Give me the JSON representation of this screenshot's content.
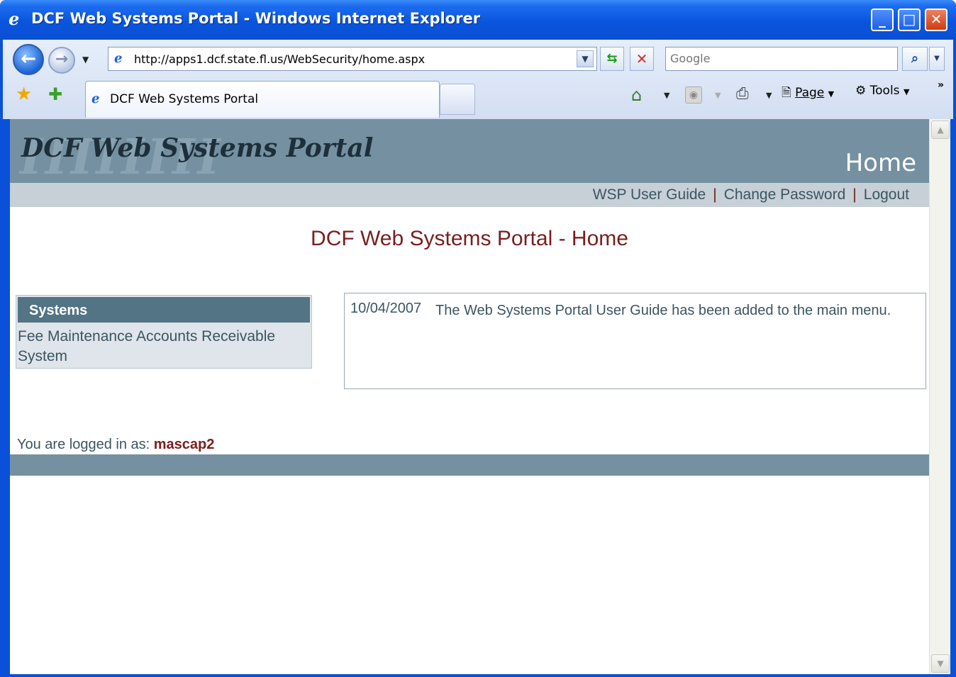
{
  "window": {
    "title": "DCF Web Systems Portal - Windows Internet Explorer",
    "minimize": "_",
    "maximize": "□",
    "close": "✕"
  },
  "browser": {
    "url": "http://apps1.dcf.state.fl.us/WebSecurity/home.aspx",
    "search_placeholder": "Google",
    "tab_label": "DCF Web Systems Portal",
    "page_label": "Page",
    "tools_label": "Tools"
  },
  "banner": {
    "logo": "DCF Web Systems Portal",
    "section": "Home"
  },
  "top_links": [
    {
      "label": "WSP User Guide"
    },
    {
      "label": "Change Password"
    },
    {
      "label": "Logout"
    }
  ],
  "top_links_separator": "|",
  "page_title": "DCF Web Systems Portal - Home",
  "systems": {
    "header": "Systems",
    "items": [
      {
        "label": "Fee Maintenance Accounts Receivable System"
      }
    ]
  },
  "news": [
    {
      "date": "10/04/2007",
      "text": "The Web Systems Portal User Guide has been added to the main menu."
    }
  ],
  "login": {
    "prefix": "You are logged in as:",
    "username": "mascap2"
  }
}
